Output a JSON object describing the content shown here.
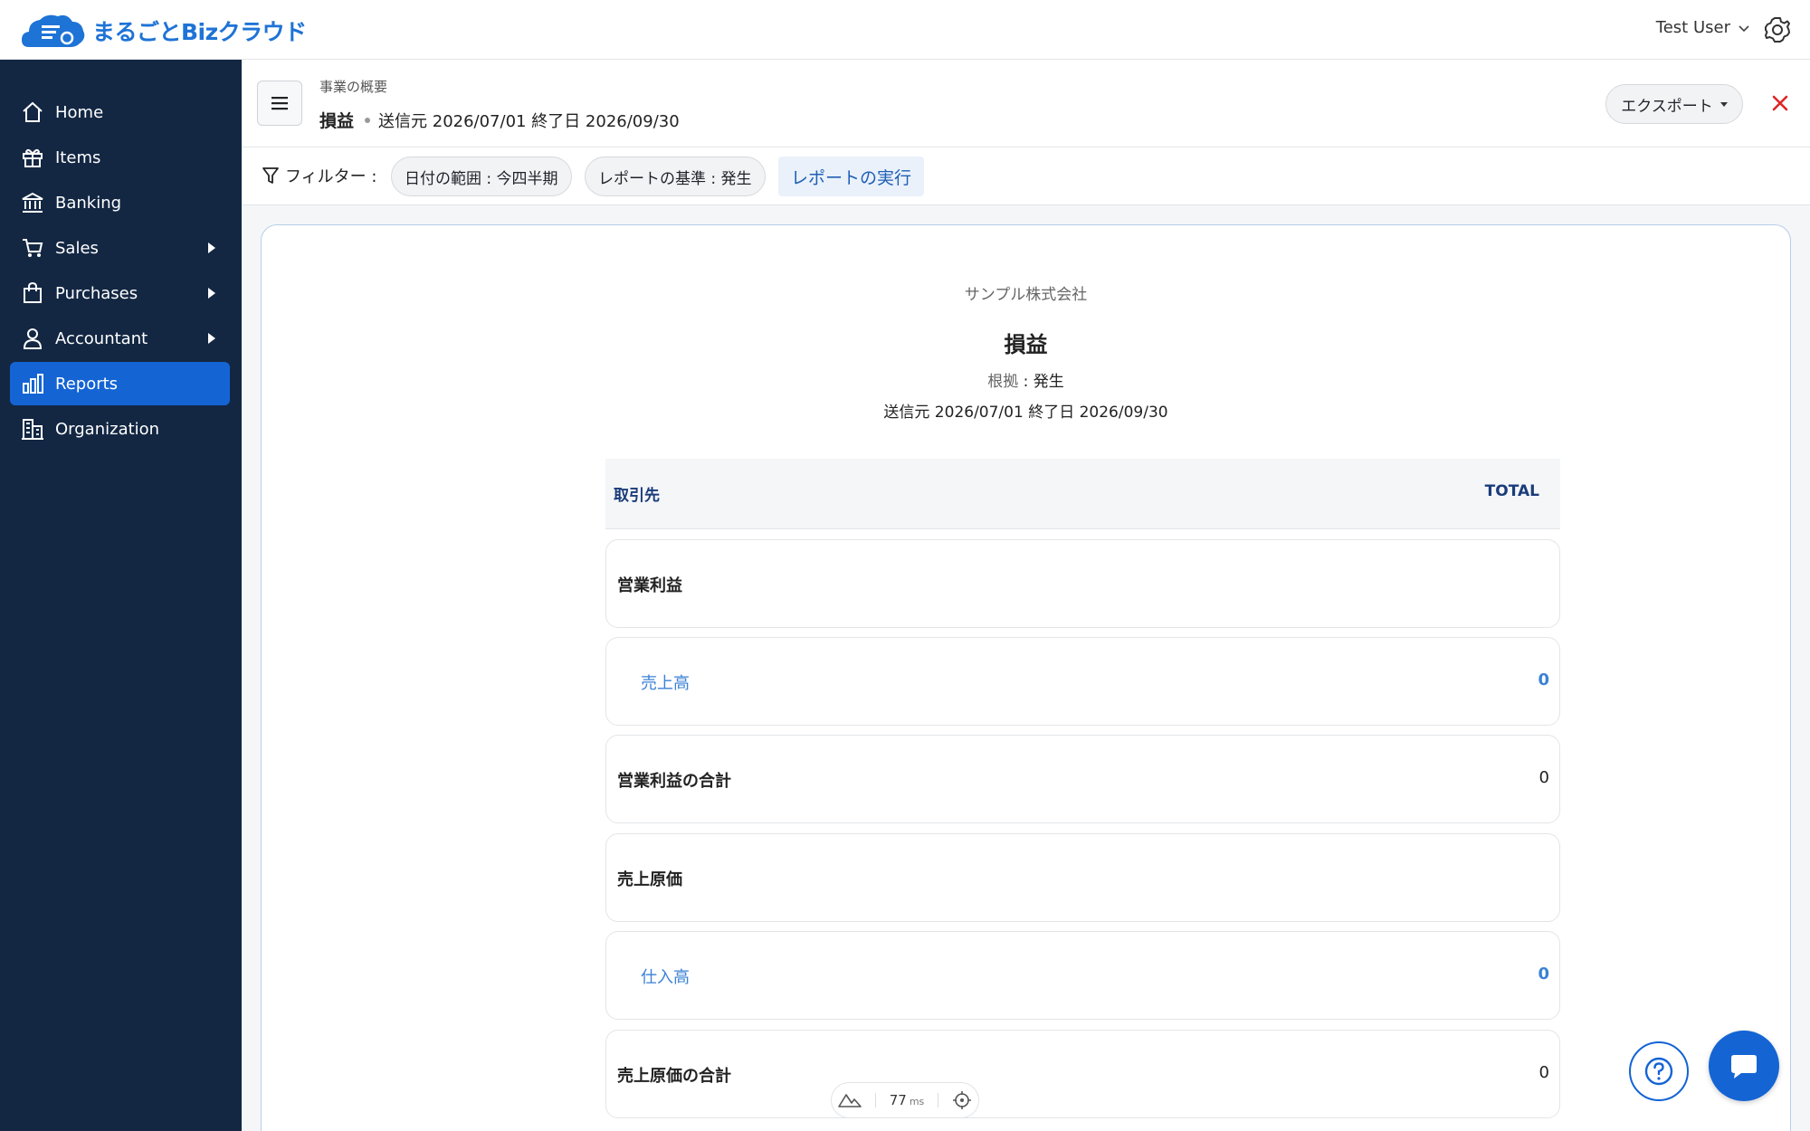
{
  "app": {
    "logo_text": "まるごとBizクラウド",
    "user_name": "Test User"
  },
  "sidebar": {
    "items": [
      {
        "label": "Home",
        "icon": "home-icon"
      },
      {
        "label": "Items",
        "icon": "gift-icon"
      },
      {
        "label": "Banking",
        "icon": "bank-icon"
      },
      {
        "label": "Sales",
        "icon": "cart-icon",
        "has_submenu": true
      },
      {
        "label": "Purchases",
        "icon": "bag-icon",
        "has_submenu": true
      },
      {
        "label": "Accountant",
        "icon": "person-icon",
        "has_submenu": true
      },
      {
        "label": "Reports",
        "icon": "bar-chart-icon",
        "active": true
      },
      {
        "label": "Organization",
        "icon": "building-icon"
      }
    ]
  },
  "header": {
    "breadcrumb": "事業の概要",
    "title": "損益",
    "period": "送信元 2026/07/01 終了日 2026/09/30",
    "export_label": "エクスポート"
  },
  "filters": {
    "label": "フィルター :",
    "date_range": "日付の範囲 : 今四半期",
    "basis": "レポートの基準 : 発生",
    "run_label": "レポートの実行"
  },
  "report": {
    "company": "サンプル株式会社",
    "title": "損益",
    "basis_key": "根拠",
    "basis_value": " : 発生",
    "period": "送信元 2026/07/01 終了日 2026/09/30",
    "columns": [
      "取引先",
      "TOTAL"
    ],
    "rows": [
      {
        "label": "営業利益",
        "value": "",
        "type": "section"
      },
      {
        "label": "売上高",
        "value": "0",
        "type": "account"
      },
      {
        "label": "営業利益の合計",
        "value": "0",
        "type": "total"
      },
      {
        "label": "売上原価",
        "value": "",
        "type": "section"
      },
      {
        "label": "仕入高",
        "value": "0",
        "type": "account"
      },
      {
        "label": "売上原価の合計",
        "value": "0",
        "type": "total"
      }
    ]
  },
  "perf": {
    "value": "77",
    "unit": "ms"
  },
  "colors": {
    "sidebar_bg": "#132743",
    "active": "#1464d4",
    "link": "#3b82d6",
    "close": "#e02424"
  }
}
